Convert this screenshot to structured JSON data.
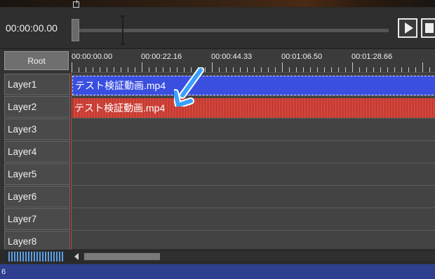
{
  "player": {
    "time": "00:00:00.00",
    "play_icon": "play-icon",
    "stop_icon": "stop-icon"
  },
  "timeline": {
    "root_label": "Root",
    "ruler_labels": [
      "00:00:00.00",
      "00:00:22.16",
      "00:00:44.33",
      "00:01:06.50",
      "00:01:28.66"
    ],
    "layers": [
      "Layer1",
      "Layer2",
      "Layer3",
      "Layer4",
      "Layer5",
      "Layer6",
      "Layer7",
      "Layer8"
    ],
    "clips": {
      "video": "テスト検証動画.mp4",
      "audio": "テスト検証動画.mp4"
    },
    "colors": {
      "video_clip": "#3a4ee0",
      "audio_clip": "#c83a30",
      "playhead": "#d04040",
      "annotation_arrow": "#3aa0ff"
    }
  },
  "statusbar": {
    "text": "6"
  }
}
